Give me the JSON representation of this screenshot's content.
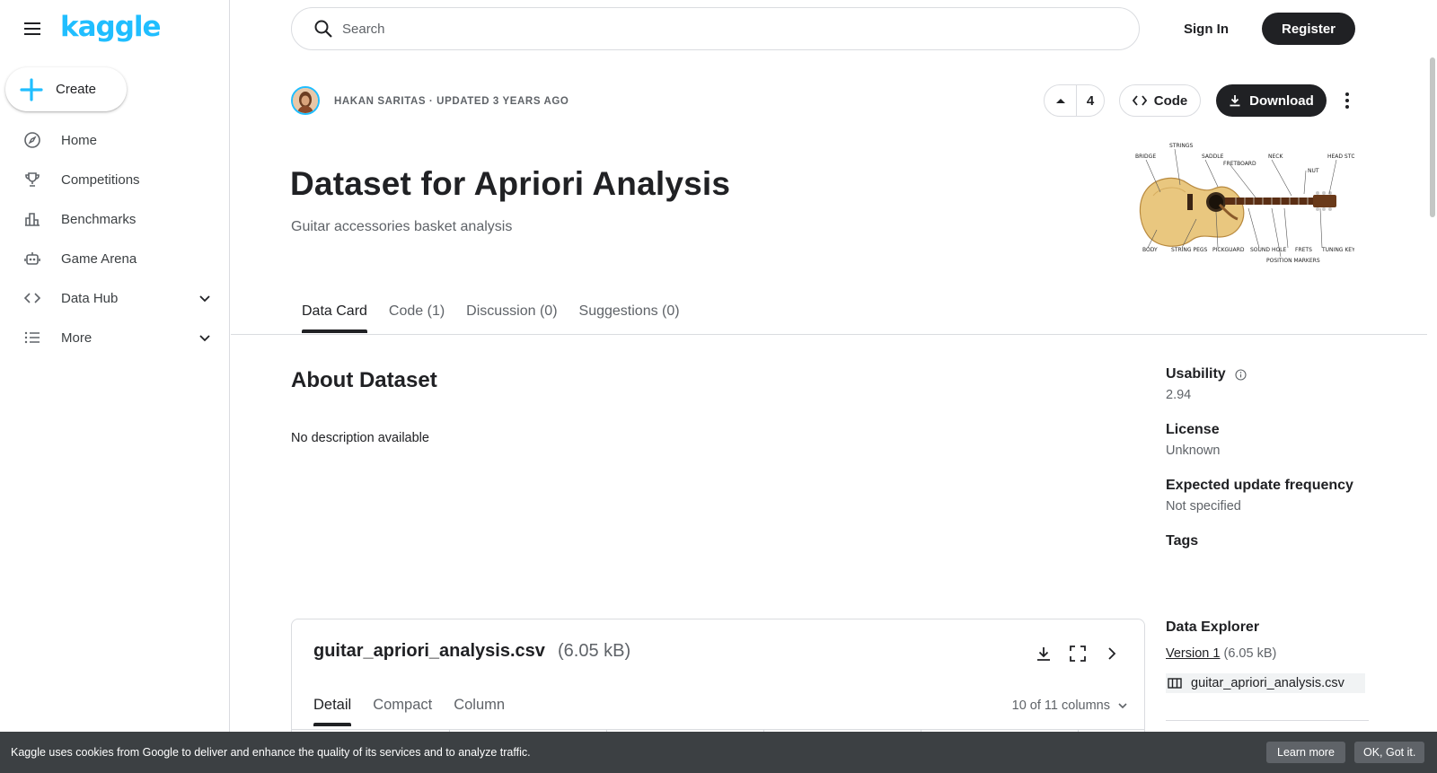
{
  "brand": {
    "logo_text": "kaggle",
    "accent": "#20beff",
    "dark": "#202124"
  },
  "sidebar": {
    "create_label": "Create",
    "items": [
      {
        "label": "Home",
        "icon": "compass-icon"
      },
      {
        "label": "Competitions",
        "icon": "trophy-icon"
      },
      {
        "label": "Benchmarks",
        "icon": "bar-chart-icon"
      },
      {
        "label": "Game Arena",
        "icon": "robot-icon"
      },
      {
        "label": "Data Hub",
        "icon": "code-brackets-icon",
        "expandable": true
      },
      {
        "label": "More",
        "icon": "list-icon",
        "expandable": true
      }
    ]
  },
  "topbar": {
    "search_placeholder": "Search",
    "signin_label": "Sign In",
    "register_label": "Register"
  },
  "dataset": {
    "byline": "HAKAN SARITAS · UPDATED 3 YEARS AGO",
    "upvotes": "4",
    "code_label": "Code",
    "download_label": "Download",
    "title": "Dataset for Apriori Analysis",
    "subtitle": "Guitar accessories basket analysis"
  },
  "tabs": [
    {
      "label": "Data Card",
      "active": true
    },
    {
      "label": "Code (1)",
      "active": false
    },
    {
      "label": "Discussion (0)",
      "active": false
    },
    {
      "label": "Suggestions (0)",
      "active": false
    }
  ],
  "about": {
    "heading": "About Dataset",
    "description": "No description available"
  },
  "meta": {
    "usability_label": "Usability",
    "usability_value": "2.94",
    "license_label": "License",
    "license_value": "Unknown",
    "frequency_label": "Expected update frequency",
    "frequency_value": "Not specified",
    "tags_label": "Tags"
  },
  "explorer": {
    "heading": "Data Explorer",
    "version_link": "Version 1",
    "version_size": "(6.05 kB)",
    "file_name": "guitar_apriori_analysis.csv"
  },
  "filecard": {
    "file_name": "guitar_apriori_analysis.csv",
    "file_size": "(6.05 kB)",
    "tabs": [
      {
        "label": "Detail",
        "active": true
      },
      {
        "label": "Compact",
        "active": false
      },
      {
        "label": "Column",
        "active": false
      }
    ],
    "columns_text": "10 of 11 columns"
  },
  "cookie": {
    "text": "Kaggle uses cookies from Google to deliver and enhance the quality of its services and to analyze traffic.",
    "learn_label": "Learn more",
    "ok_label": "OK, Got it."
  }
}
